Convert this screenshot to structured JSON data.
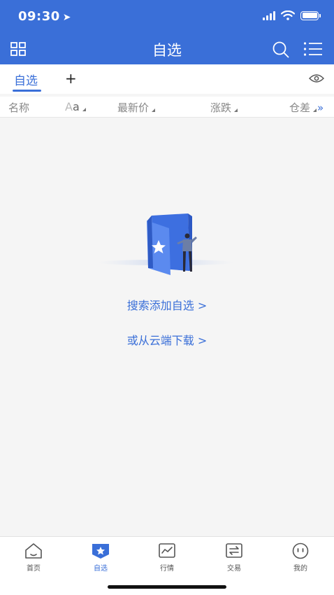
{
  "status_bar": {
    "time": "09:30"
  },
  "header": {
    "title": "自选"
  },
  "tabs": {
    "active_label": "自选",
    "add_label": "+"
  },
  "columns": {
    "name": "名称",
    "aa_first": "A",
    "aa_second": "a",
    "latest_price": "最新价",
    "change": "涨跌",
    "open_interest_diff": "仓差",
    "more": "»"
  },
  "empty_state": {
    "search_add_link": "搜索添加自选 >",
    "cloud_download_link": "或从云端下载 >"
  },
  "bottom_nav": {
    "items": [
      {
        "label": "首页",
        "icon": "home-icon"
      },
      {
        "label": "自选",
        "icon": "watchlist-icon",
        "active": true
      },
      {
        "label": "行情",
        "icon": "market-chart-icon"
      },
      {
        "label": "交易",
        "icon": "trade-icon"
      },
      {
        "label": "我的",
        "icon": "profile-icon"
      }
    ]
  },
  "colors": {
    "primary": "#3a6fd8",
    "background": "#f5f5f5",
    "muted_text": "#888888"
  }
}
